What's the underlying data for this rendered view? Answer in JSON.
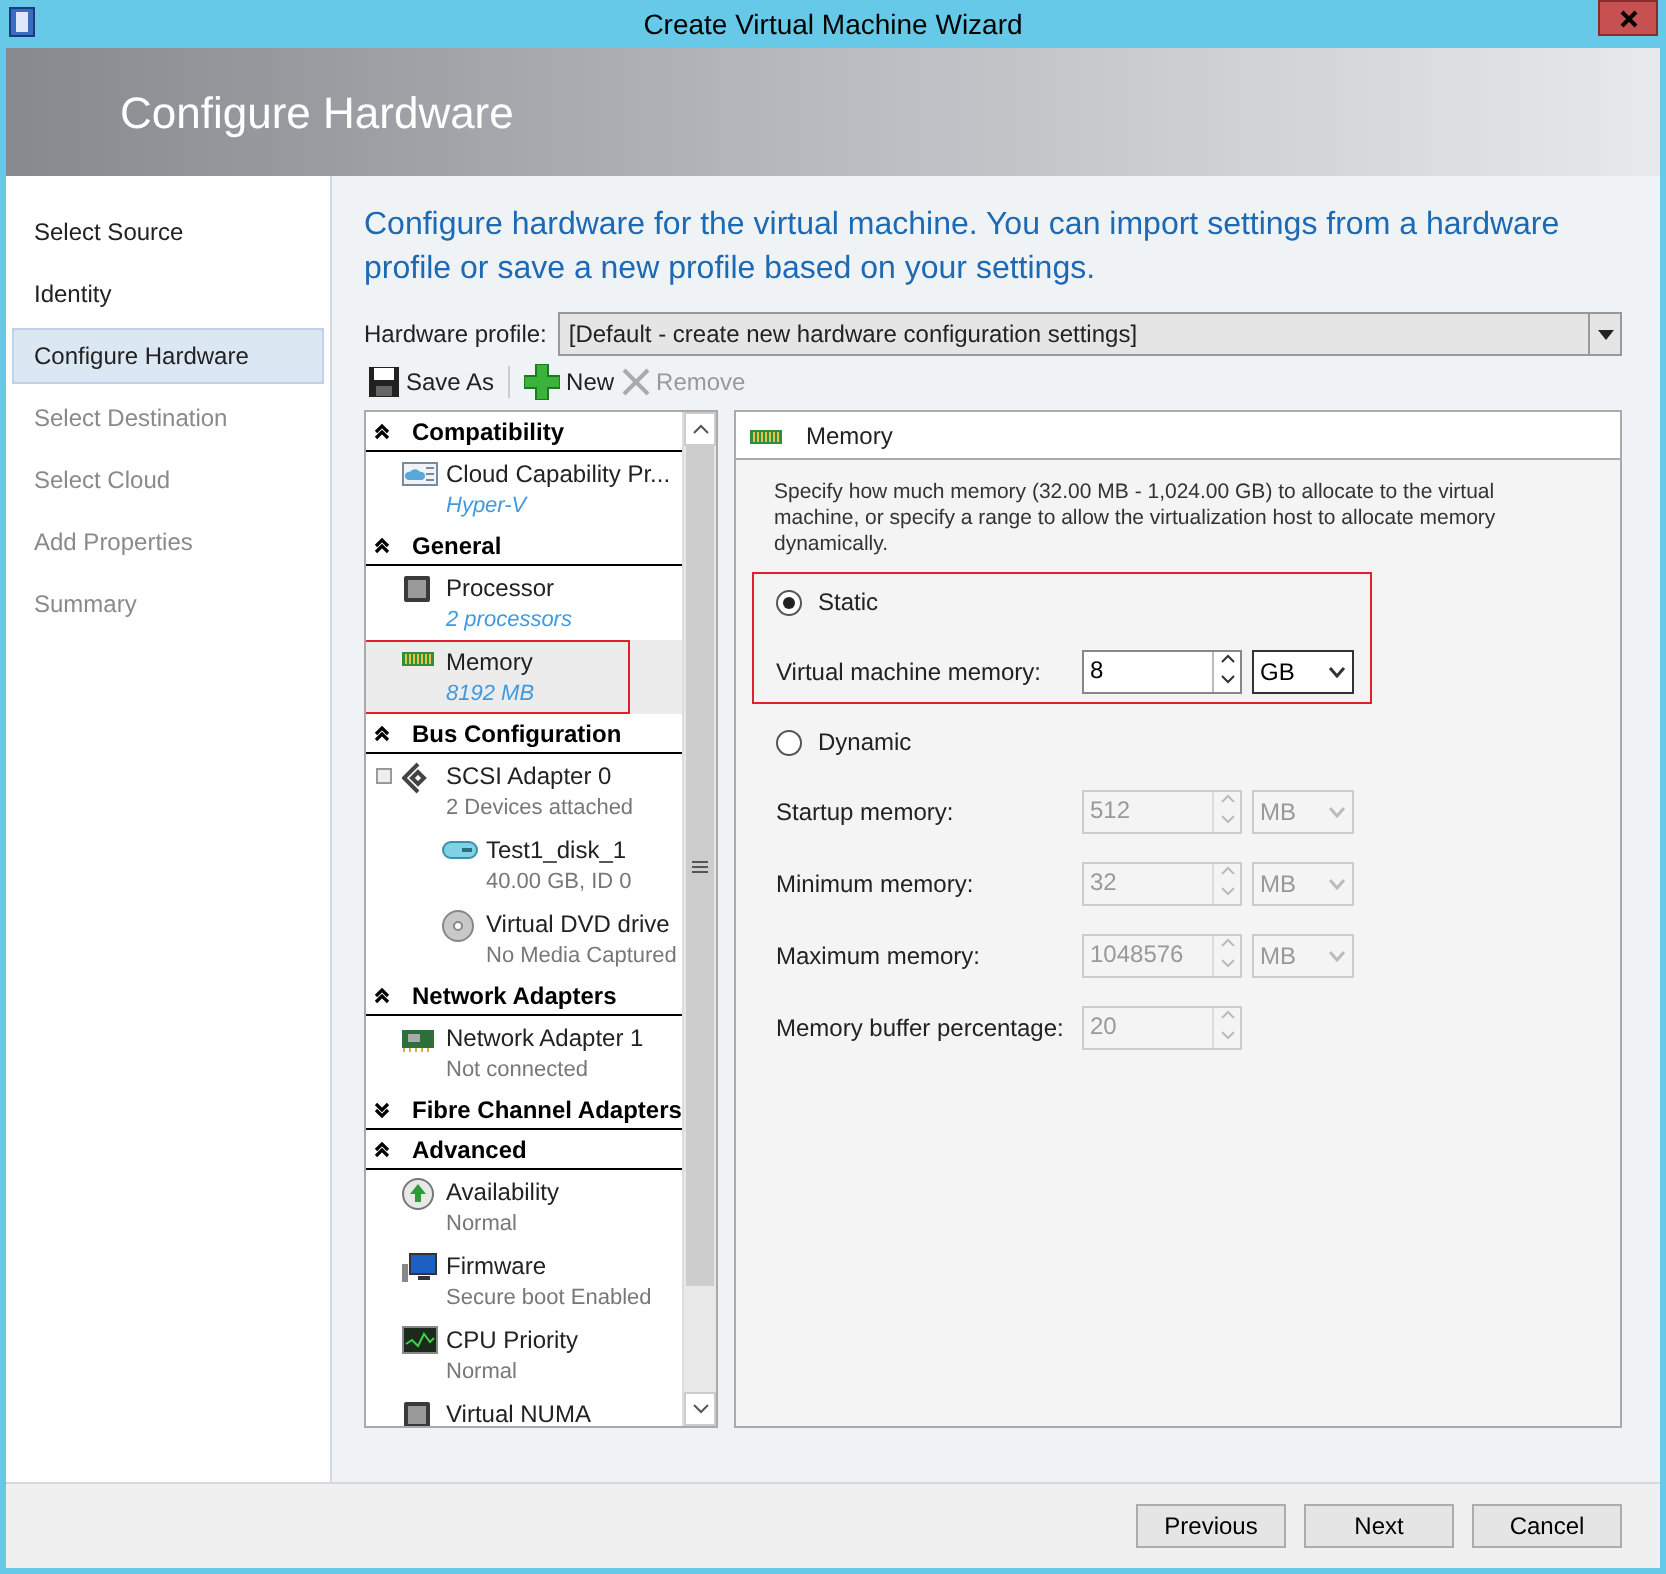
{
  "window": {
    "title": "Create Virtual Machine Wizard"
  },
  "header": {
    "title": "Configure Hardware"
  },
  "steps": [
    {
      "label": "Select Source",
      "selected": false,
      "disabled": false
    },
    {
      "label": "Identity",
      "selected": false,
      "disabled": false
    },
    {
      "label": "Configure Hardware",
      "selected": true,
      "disabled": false
    },
    {
      "label": "Select Destination",
      "selected": false,
      "disabled": true
    },
    {
      "label": "Select Cloud",
      "selected": false,
      "disabled": true
    },
    {
      "label": "Add Properties",
      "selected": false,
      "disabled": true
    },
    {
      "label": "Summary",
      "selected": false,
      "disabled": true
    }
  ],
  "intro": "Configure hardware for the virtual machine. You can import settings from a hardware profile or save a new profile based on your settings.",
  "hardware_profile": {
    "label": "Hardware profile:",
    "value": "[Default - create new hardware configuration settings]"
  },
  "toolbar": [
    {
      "label": "Save As",
      "kind": "disk",
      "disabled": false
    },
    {
      "label": "New",
      "kind": "plus",
      "disabled": false
    },
    {
      "label": "Remove",
      "kind": "cross",
      "disabled": true
    }
  ],
  "tree": [
    {
      "label": "Compatibility",
      "expanded": true,
      "items": [
        {
          "name": "Cloud Capability Pr...",
          "detail": "Hyper-V",
          "detail_is_link": true,
          "kind": "cloud",
          "selected": false,
          "highlighted": false
        }
      ]
    },
    {
      "label": "General",
      "expanded": true,
      "items": [
        {
          "name": "Processor",
          "detail": "2 processors",
          "detail_is_link": true,
          "kind": "chip",
          "selected": false,
          "highlighted": false
        },
        {
          "name": "Memory",
          "detail": "8192 MB",
          "detail_is_link": true,
          "kind": "ram",
          "selected": true,
          "highlighted": true
        }
      ]
    },
    {
      "label": "Bus Configuration",
      "expanded": true,
      "items": [
        {
          "name": "SCSI Adapter 0",
          "detail": "2 Devices attached",
          "detail_is_link": false,
          "kind": "scsi",
          "selected": false,
          "highlighted": false,
          "children": [
            {
              "name": "Test1_disk_1",
              "detail": "40.00 GB, ID 0",
              "detail_is_link": false,
              "kind": "hdd",
              "selected": false,
              "highlighted": false
            },
            {
              "name": "Virtual DVD drive",
              "detail": "No Media Captured",
              "detail_is_link": false,
              "kind": "dvd",
              "selected": false,
              "highlighted": false
            }
          ]
        }
      ]
    },
    {
      "label": "Network Adapters",
      "expanded": true,
      "items": [
        {
          "name": "Network Adapter 1",
          "detail": "Not connected",
          "detail_is_link": false,
          "kind": "nic",
          "selected": false,
          "highlighted": false
        }
      ]
    },
    {
      "label": "Fibre Channel Adapters",
      "expanded": false
    },
    {
      "label": "Advanced",
      "expanded": true,
      "items": [
        {
          "name": "Availability",
          "detail": "Normal",
          "detail_is_link": false,
          "kind": "up",
          "selected": false,
          "highlighted": false
        },
        {
          "name": "Firmware",
          "detail": "Secure boot Enabled",
          "detail_is_link": false,
          "kind": "monitor",
          "selected": false,
          "highlighted": false
        },
        {
          "name": "CPU Priority",
          "detail": "Normal",
          "detail_is_link": false,
          "kind": "graph",
          "selected": false,
          "highlighted": false
        },
        {
          "name": "Virtual NUMA",
          "kind": "chip",
          "selected": false,
          "highlighted": false
        }
      ]
    }
  ],
  "memory_panel": {
    "title": "Memory",
    "description": "Specify how much memory (32.00 MB - 1,024.00 GB) to allocate to the virtual machine, or specify a range to allow the virtualization host to allocate memory dynamically.",
    "options": [
      {
        "label": "Static",
        "selected": true,
        "highlighted": true,
        "fields": [
          {
            "label": "Virtual machine memory:",
            "value": "8",
            "unit": "GB",
            "disabled": false
          }
        ]
      },
      {
        "label": "Dynamic",
        "selected": false,
        "highlighted": false,
        "fields": [
          {
            "label": "Startup memory:",
            "value": "512",
            "unit": "MB",
            "disabled": true
          },
          {
            "label": "Minimum memory:",
            "value": "32",
            "unit": "MB",
            "disabled": true
          },
          {
            "label": "Maximum memory:",
            "value": "1048576",
            "unit": "MB",
            "disabled": true
          },
          {
            "label": "Memory buffer percentage:",
            "value": "20",
            "disabled": true
          }
        ]
      }
    ]
  },
  "buttons": [
    "Previous",
    "Next",
    "Cancel"
  ]
}
